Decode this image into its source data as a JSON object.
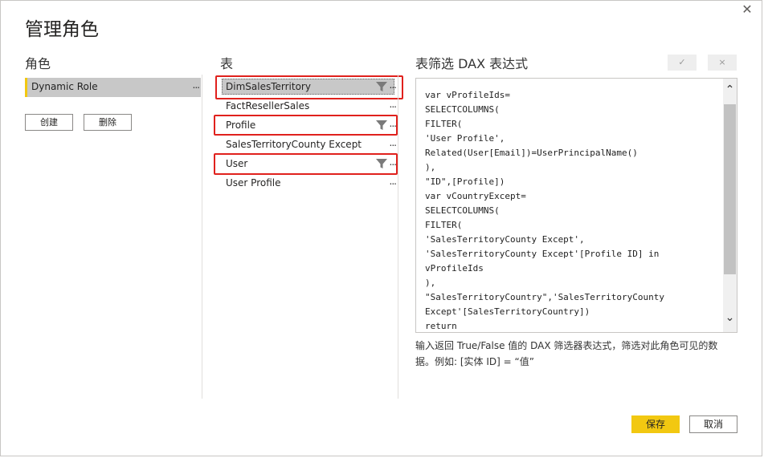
{
  "dialog": {
    "title": "管理角色",
    "close_icon": "✕"
  },
  "roles": {
    "header": "角色",
    "items": [
      {
        "label": "Dynamic Role",
        "more": "..."
      }
    ],
    "create_label": "创建",
    "delete_label": "删除"
  },
  "tables": {
    "header": "表",
    "items": [
      {
        "label": "DimSalesTerritory",
        "more": "...",
        "filtered": true,
        "selected": true
      },
      {
        "label": "FactResellerSales",
        "more": "...",
        "filtered": false,
        "selected": false
      },
      {
        "label": "Profile",
        "more": "...",
        "filtered": true,
        "selected": false
      },
      {
        "label": "SalesTerritoryCounty Except",
        "more": "...",
        "filtered": false,
        "selected": false
      },
      {
        "label": "User",
        "more": "...",
        "filtered": true,
        "selected": false
      },
      {
        "label": "User Profile",
        "more": "...",
        "filtered": false,
        "selected": false
      }
    ]
  },
  "dax": {
    "header": "表筛选 DAX 表达式",
    "check_icon": "✓",
    "clear_icon": "×",
    "code": "var vProfileIds=\nSELECTCOLUMNS(\nFILTER(\n'User Profile',\nRelated(User[Email])=UserPrincipalName()\n),\n\"ID\",[Profile])\nvar vCountryExcept=\nSELECTCOLUMNS(\nFILTER(\n'SalesTerritoryCounty Except',\n'SalesTerritoryCounty Except'[Profile ID] in\nvProfileIds\n),\n\"SalesTerritoryCountry\",'SalesTerritoryCounty\nExcept'[SalesTerritoryCountry])\nreturn",
    "hint": "输入返回 True/False 值的 DAX 筛选器表达式，筛选对此角色可见的数据。例如: [实体 ID] = “值”",
    "scroll_up_icon": "⌃",
    "scroll_down_icon": "⌄"
  },
  "footer": {
    "save_label": "保存",
    "cancel_label": "取消"
  },
  "colors": {
    "accent": "#f2c811",
    "highlight": "#e0211d",
    "selected_bg": "#c8c8c8"
  }
}
